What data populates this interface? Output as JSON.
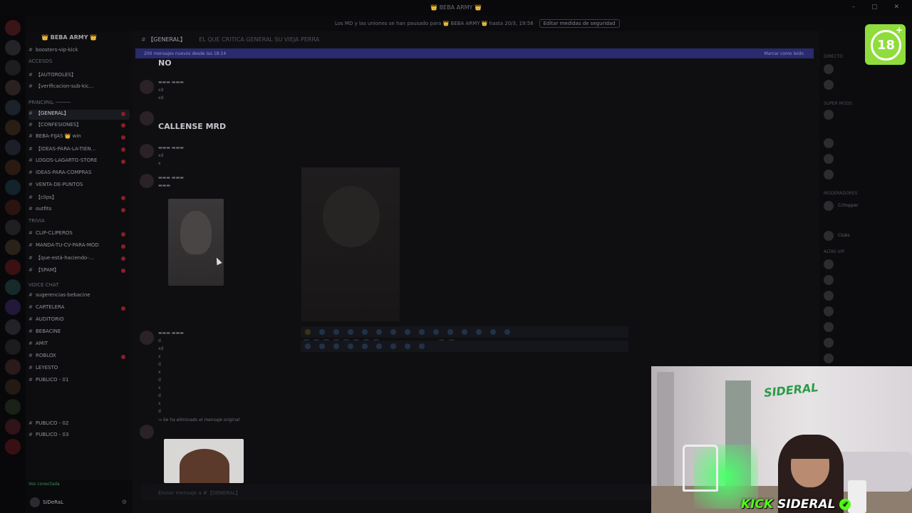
{
  "window": {
    "title": "👑 BEBA ARMY 👑"
  },
  "notice": {
    "text": "Los MD y las uniones se han pausado para 👑 BEBA ARMY 👑 hasta 20/3, 19:58",
    "button": "Editar medidas de seguridad"
  },
  "server": {
    "name": "👑 BEBA ARMY 👑"
  },
  "channels": [
    {
      "label": "boosters-vip-kick",
      "type": "channel",
      "active": false,
      "badge": false
    },
    {
      "label": "ACCESOS",
      "type": "category",
      "active": false,
      "badge": false
    },
    {
      "label": "【AUTOROLES】",
      "type": "channel",
      "active": false,
      "badge": false
    },
    {
      "label": "【verificacion-sub-kic...",
      "type": "channel",
      "active": false,
      "badge": false
    },
    {
      "label": "PRINCIPAL ─────",
      "type": "category",
      "active": false,
      "badge": false
    },
    {
      "label": "【GENERAL】",
      "type": "channel",
      "active": true,
      "badge": true
    },
    {
      "label": "【CONFESIONES】",
      "type": "channel",
      "active": false,
      "badge": true
    },
    {
      "label": "BEBA-FIJAS 👑 win",
      "type": "channel",
      "active": false,
      "badge": true
    },
    {
      "label": "【IDEAS-PARA-LA-TIEN...",
      "type": "channel",
      "active": false,
      "badge": true
    },
    {
      "label": "LOGOS-LAGARTO-STORE",
      "type": "channel",
      "active": false,
      "badge": true
    },
    {
      "label": "IDEAS-PARA-COMPRAS",
      "type": "channel",
      "active": false,
      "badge": false
    },
    {
      "label": "VENTA-DE-PUNTOS",
      "type": "channel",
      "active": false,
      "badge": false
    },
    {
      "label": "【clips】",
      "type": "channel",
      "active": false,
      "badge": true
    },
    {
      "label": "outfits",
      "type": "channel",
      "active": false,
      "badge": true
    },
    {
      "label": "TRIVIA",
      "type": "category",
      "active": false,
      "badge": false
    },
    {
      "label": "CLIP-CLIPEROS",
      "type": "channel",
      "active": false,
      "badge": true
    },
    {
      "label": "MANDA-TU-CV-PARA-MOD",
      "type": "channel",
      "active": false,
      "badge": true
    },
    {
      "label": "【que-está-haciendo-...",
      "type": "channel",
      "active": false,
      "badge": true
    },
    {
      "label": "【SPAM】",
      "type": "channel",
      "active": false,
      "badge": true
    },
    {
      "label": "VOICE CHAT",
      "type": "category",
      "active": false,
      "badge": false
    },
    {
      "label": "sugerencias-bebacine",
      "type": "channel",
      "active": false,
      "badge": false
    },
    {
      "label": "CARTELERA",
      "type": "channel",
      "active": false,
      "badge": true
    },
    {
      "label": "AUDITORIO",
      "type": "channel",
      "active": false,
      "badge": false
    },
    {
      "label": "BEBACINE",
      "type": "channel",
      "active": false,
      "badge": false
    },
    {
      "label": "AMIT",
      "type": "channel",
      "active": false,
      "badge": false
    },
    {
      "label": "ROBLOX",
      "type": "channel",
      "active": false,
      "badge": true
    },
    {
      "label": "LEYESTO",
      "type": "channel",
      "active": false,
      "badge": false
    },
    {
      "label": "PUBLICO - 01",
      "type": "channel",
      "active": false,
      "badge": false
    },
    {
      "label": "PUBLICO - 02",
      "type": "channel",
      "active": false,
      "badge": false
    },
    {
      "label": "PUBLICO - 03",
      "type": "channel",
      "active": false,
      "badge": false
    }
  ],
  "user": {
    "name": "SiDeRaL",
    "status": "Voz conectada"
  },
  "main": {
    "channel": "【GENERAL】",
    "topic": "EL QUE CRITICA GENERAL SU VIEJA PERRA",
    "new_messages": "200 mensajes nuevos desde las 18:14",
    "mark_read": "Marcar como leído",
    "big_no": "NO",
    "big_callense": "CALLENSE MRD",
    "reply_text": "↪ Se ha eliminado el mensaje original",
    "input_placeholder": "Enviar mensaje a #【GENERAL】"
  },
  "members": {
    "cats": [
      "DIRECTO",
      "SUPER MODS",
      "MODERADORES",
      "ALTAS VIP"
    ],
    "items": [
      {
        "name": "Cchopper"
      },
      {
        "name": "Clubs"
      }
    ]
  },
  "badge18": {
    "text": "18",
    "plus": "+"
  },
  "stream": {
    "platform": "KICK",
    "channel": "SIDERAL",
    "overlay_logo": "SIDERAL"
  }
}
